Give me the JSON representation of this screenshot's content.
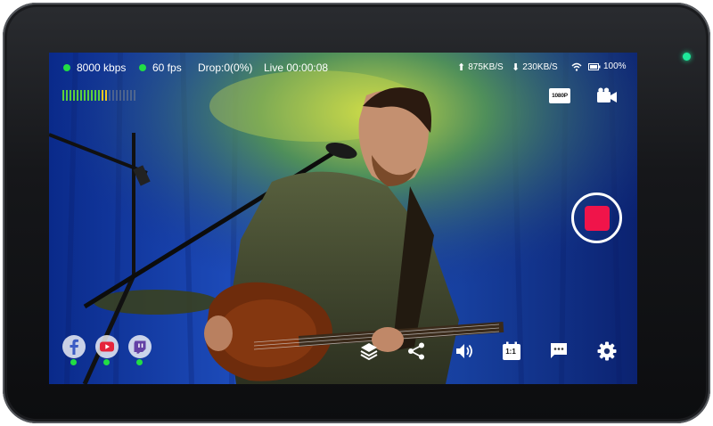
{
  "status": {
    "bitrate": "8000 kbps",
    "fps": "60 fps",
    "drop": "Drop:0(0%)",
    "live": "Live 00:00:08",
    "upload": "875KB/S",
    "download": "230KB/S",
    "battery": "100%"
  },
  "top_controls": {
    "resolution": "1080P"
  },
  "tools": {
    "aspect_ratio": "1:1"
  },
  "platforms": [
    "facebook",
    "youtube",
    "twitch"
  ],
  "audio_meter": {
    "level": 0.62
  },
  "colors": {
    "live_dot": "#22dd44",
    "record": "#f0144a",
    "indicator_led": "#1ee89a"
  }
}
